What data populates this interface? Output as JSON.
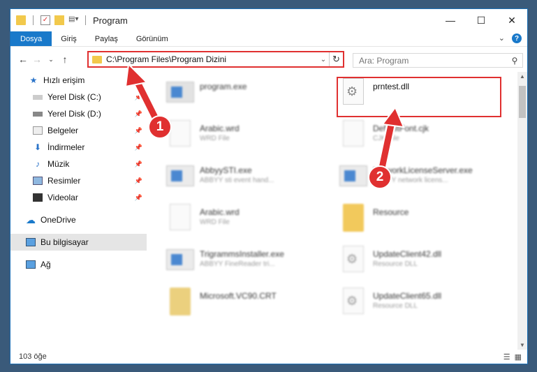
{
  "window": {
    "title": "Program",
    "controls": [
      "—",
      "☐",
      "✕"
    ]
  },
  "ribbon": {
    "tabs": [
      "Dosya",
      "Giriş",
      "Paylaş",
      "Görünüm"
    ],
    "help": "?"
  },
  "nav": {
    "path": "C:\\Program Files\\Program Dizini",
    "search_placeholder": "Ara: Program"
  },
  "sidebar": {
    "items": [
      {
        "label": "Hızlı erişim",
        "icon": "star-icon"
      },
      {
        "label": "Yerel Disk (C:)",
        "icon": "drive-icon",
        "pinned": true
      },
      {
        "label": "Yerel Disk (D:)",
        "icon": "drive-icon",
        "pinned": true
      },
      {
        "label": "Belgeler",
        "icon": "documents-icon",
        "pinned": true
      },
      {
        "label": "İndirmeler",
        "icon": "download-icon",
        "pinned": true
      },
      {
        "label": "Müzik",
        "icon": "music-icon",
        "pinned": true
      },
      {
        "label": "Resimler",
        "icon": "pictures-icon",
        "pinned": true
      },
      {
        "label": "Videolar",
        "icon": "videos-icon",
        "pinned": true
      },
      {
        "label": "OneDrive",
        "icon": "cloud-icon"
      },
      {
        "label": "Bu bilgisayar",
        "icon": "computer-icon",
        "selected": true
      },
      {
        "label": "Ağ",
        "icon": "network-icon"
      }
    ]
  },
  "files": [
    {
      "name": "program.exe",
      "sub": "",
      "type": "exe"
    },
    {
      "name": "prntest.dll",
      "sub": "",
      "type": "dll"
    },
    {
      "name": "Arabic.wrd",
      "sub": "WRD File",
      "type": "doc"
    },
    {
      "name": "DefaultFont.cjk",
      "sub": "CJK File",
      "type": "doc"
    },
    {
      "name": "AbbyySTI.exe",
      "sub": "ABBYY sti event hand...",
      "type": "exe"
    },
    {
      "name": "NetworkLicenseServer.exe",
      "sub": "ABBYY network licens...",
      "type": "exe"
    },
    {
      "name": "Arabic.wrd",
      "sub": "WRD File",
      "type": "doc"
    },
    {
      "name": "Resource",
      "sub": "",
      "type": "folder"
    },
    {
      "name": "TrigrammsInstaller.exe",
      "sub": "ABBYY FineReader tri...",
      "type": "exe"
    },
    {
      "name": "UpdateClient42.dll",
      "sub": "Resource DLL",
      "type": "dll"
    },
    {
      "name": "Microsoft.VC90.CRT",
      "sub": "",
      "type": "folder"
    },
    {
      "name": "UpdateClient65.dll",
      "sub": "Resource DLL",
      "type": "dll"
    }
  ],
  "status": {
    "count": "103 öğe"
  },
  "annotations": {
    "callout1": "1",
    "callout2": "2",
    "color": "#e03030"
  }
}
